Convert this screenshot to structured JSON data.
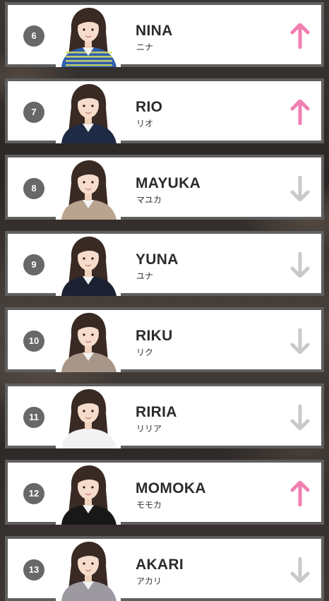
{
  "colors": {
    "up": "#f17fb1",
    "down": "#c9c9c9",
    "rank_badge": "#686868",
    "card_border": "#5f5f5f"
  },
  "ranking": [
    {
      "rank": "6",
      "name": "NINA",
      "kana": "ニナ",
      "trend": "up",
      "trend_icon": "arrow-up-icon",
      "shirt": "#2f5fb0",
      "stripe": true
    },
    {
      "rank": "7",
      "name": "RIO",
      "kana": "リオ",
      "trend": "up",
      "trend_icon": "arrow-up-icon",
      "shirt": "#1f2a44",
      "stripe": false
    },
    {
      "rank": "8",
      "name": "MAYUKA",
      "kana": "マユカ",
      "trend": "down",
      "trend_icon": "arrow-down-icon",
      "shirt": "#b9a48f",
      "stripe": false
    },
    {
      "rank": "9",
      "name": "YUNA",
      "kana": "ユナ",
      "trend": "down",
      "trend_icon": "arrow-down-icon",
      "shirt": "#1d2233",
      "stripe": false
    },
    {
      "rank": "10",
      "name": "RIKU",
      "kana": "リク",
      "trend": "down",
      "trend_icon": "arrow-down-icon",
      "shirt": "#a89788",
      "stripe": false
    },
    {
      "rank": "11",
      "name": "RIRIA",
      "kana": "リリア",
      "trend": "down",
      "trend_icon": "arrow-down-icon",
      "shirt": "#f2f2f2",
      "stripe": false
    },
    {
      "rank": "12",
      "name": "MOMOKA",
      "kana": "モモカ",
      "trend": "up",
      "trend_icon": "arrow-up-icon",
      "shirt": "#181818",
      "stripe": false
    },
    {
      "rank": "13",
      "name": "AKARI",
      "kana": "アカリ",
      "trend": "down",
      "trend_icon": "arrow-down-icon",
      "shirt": "#9c9aa0",
      "stripe": false
    }
  ]
}
